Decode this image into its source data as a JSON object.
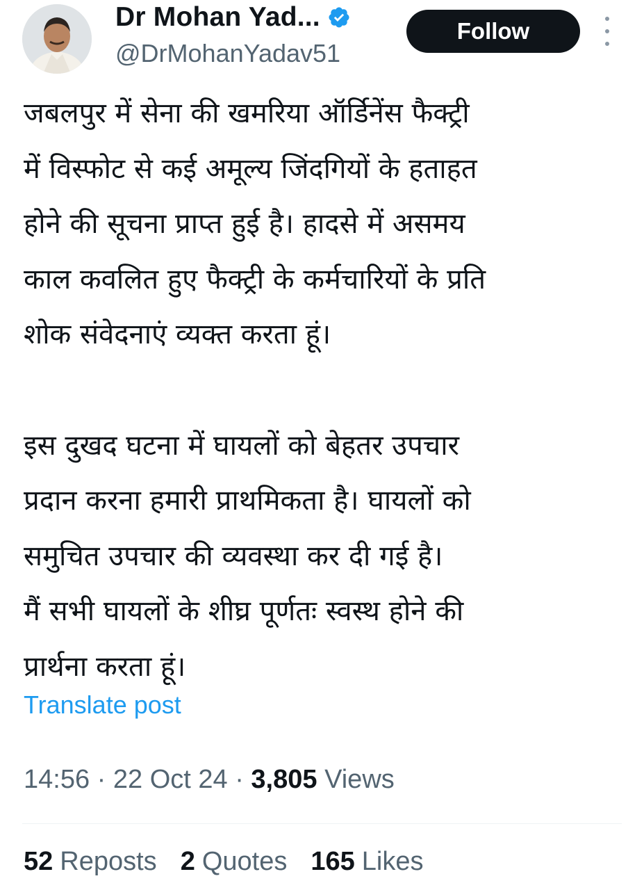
{
  "author": {
    "display_name": "Dr Mohan Yad...",
    "handle": "@DrMohanYadav51",
    "avatar_icon": "profile-photo",
    "verified_icon": "verified-badge-icon",
    "verified_color": "#1d9bf0"
  },
  "actions": {
    "follow_label": "Follow",
    "more_icon": "more-vertical-icon"
  },
  "tweet": {
    "paragraph1": [
      "जबलपुर में सेना की खमरिया ऑर्डिनेंस फैक्ट्री",
      "में विस्फोट से कई अमूल्य जिंदगियों के हताहत",
      "होने की सूचना प्राप्त हुई है। हादसे में असमय",
      "काल कवलित हुए फैक्ट्री के कर्मचारियों के प्रति",
      "शोक संवेदनाएं व्यक्त करता हूं।"
    ],
    "paragraph2": [
      "इस दुखद घटना में घायलों को बेहतर उपचार",
      "प्रदान करना हमारी प्राथमिकता है। घायलों को",
      "समुचित उपचार की व्यवस्था कर दी गई है।",
      "मैं सभी घायलों के शीघ्र पूर्णतः स्वस्थ होने की",
      "प्रार्थना करता हूं।"
    ],
    "translate_label": "Translate post"
  },
  "meta": {
    "time": "14:56",
    "separator": "·",
    "date": "22 Oct 24",
    "views_count": "3,805",
    "views_label": "Views"
  },
  "stats": {
    "reposts_count": "52",
    "reposts_label": "Reposts",
    "quotes_count": "2",
    "quotes_label": "Quotes",
    "likes_count": "165",
    "likes_label": "Likes"
  },
  "colors": {
    "link": "#1d9bf0",
    "secondary_text": "#536471",
    "primary_text": "#0f1419",
    "follow_bg": "#0f1419"
  }
}
